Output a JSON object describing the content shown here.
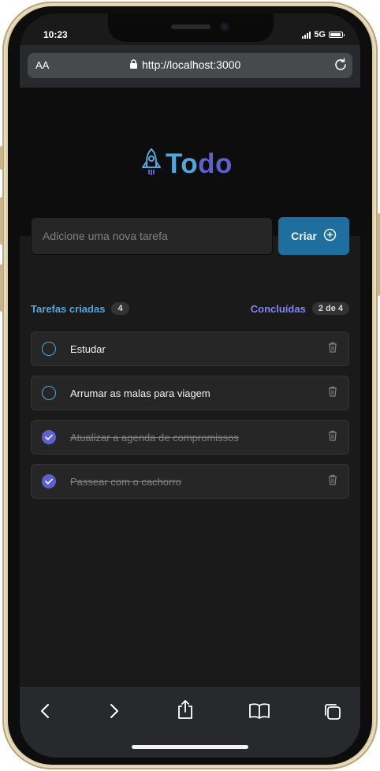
{
  "status_bar": {
    "time": "10:23",
    "network": "5G",
    "battery_level": 0.9
  },
  "browser": {
    "text_size_label": "AA",
    "url": "http://localhost:3000"
  },
  "app": {
    "brand_part1": "To",
    "brand_part2": "do",
    "input_placeholder": "Adicione uma nova tarefa",
    "create_label": "Criar",
    "created_label": "Tarefas criadas",
    "created_count": "4",
    "done_label": "Concluídas",
    "done_count": "2 de 4",
    "tasks": [
      {
        "text": "Estudar",
        "done": false
      },
      {
        "text": "Arrumar as malas para viagem",
        "done": false
      },
      {
        "text": "Atualizar a agenda de compromissos",
        "done": true
      },
      {
        "text": "Passear com o cachorro",
        "done": true
      }
    ]
  },
  "colors": {
    "blue": "#4ea8de",
    "purple": "#5e60ce",
    "button": "#1e6f9f",
    "background": "#1a1a1a",
    "header": "#0d0d0d"
  },
  "icons": {
    "brand": "rocket-icon",
    "create": "plus-circle-icon",
    "task_action": "trash-icon",
    "nav": [
      "back-icon",
      "forward-icon",
      "share-icon",
      "bookmarks-icon",
      "tabs-icon"
    ]
  }
}
